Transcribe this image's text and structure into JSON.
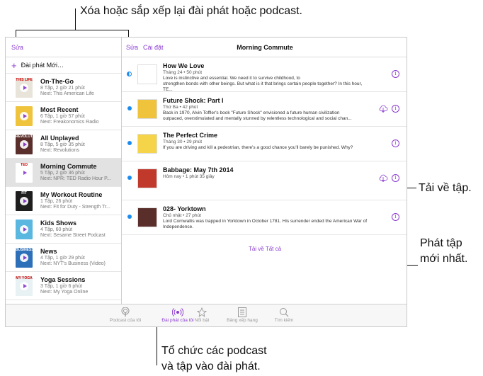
{
  "callouts": {
    "top": "Xóa hoặc sắp xếp lại đài phát hoặc podcast.",
    "download": "Tải về tập.",
    "play_line1": "Phát tập",
    "play_line2": "mới nhất.",
    "organize_line1": "Tổ chức các podcast",
    "organize_line2": "và tập vào đài phát."
  },
  "sidebar": {
    "edit": "Sửa",
    "new_station": "Đài phát Mới…",
    "stations": [
      {
        "name": "On-The-Go",
        "info": "8 Tập, 2 giờ 21 phút",
        "next": "Next: This American Life",
        "art_color": "#e8e4da",
        "art_label": "THIS LIFE"
      },
      {
        "name": "Most Recent",
        "info": "6 Tập, 1 giờ 57 phút",
        "next": "Next: Freakonomics Radio",
        "art_color": "#f0c33c",
        "art_label": ""
      },
      {
        "name": "All Unplayed",
        "info": "8 Tập, 5 giờ 35 phút",
        "next": "Next: Revolutions",
        "art_color": "#5a2f2b",
        "art_label": "REVOLUTIONS"
      },
      {
        "name": "Morning Commute",
        "info": "5 Tập, 2 giờ 36 phút",
        "next": "Next: NPR: TED Radio Hour P...",
        "art_color": "#ffffff",
        "art_label": "TED"
      },
      {
        "name": "My Workout Routine",
        "info": "1 Tập, 26 phút",
        "next": "Next: Fit for Duty - Strength Tr...",
        "art_color": "#1e1e1e",
        "art_label": "FIT"
      },
      {
        "name": "Kids Shows",
        "info": "4 Tập, 60 phút",
        "next": "Next: Sesame Street Podcast",
        "art_color": "#5ab7e0",
        "art_label": ""
      },
      {
        "name": "News",
        "info": "4 Tập, 1 giờ 29 phút",
        "next": "Next: NYT's Business (Video)",
        "art_color": "#2d6fb8",
        "art_label": "BUSINESS"
      },
      {
        "name": "Yoga Sessions",
        "info": "3 Tập, 1 giờ 6 phút",
        "next": "Next: My Yoga Online",
        "art_color": "#e8f1f4",
        "art_label": "MY YOGA"
      }
    ]
  },
  "main": {
    "edit": "Sửa",
    "settings": "Cài đặt",
    "title": "Morning Commute",
    "episodes": [
      {
        "title": "How We Love",
        "meta": "Tháng 24 • 50 phút",
        "desc1": "Love is instinctive and essential. We need it to survive childhood, to",
        "desc2": "strengthen bonds with other beings. But what is it that brings certain people together? In this hour, TE...",
        "dot": "half",
        "cloud": false,
        "thumb_color": "#ffffff"
      },
      {
        "title": "Future Shock: Part I",
        "meta": "Thứ Ba • 42 phút",
        "desc1": "Back in 1970, Alvin Toffler's book \"Future Shock\" envisioned a future human civilization",
        "desc2": "outpaced, overstimulated and mentally stunned by relentless technological and social chan...",
        "dot": "full",
        "cloud": true,
        "thumb_color": "#f0c33c"
      },
      {
        "title": "The Perfect Crime",
        "meta": "Tháng 30 • 29 phút",
        "desc1": "If you are driving and kill a pedestrian, there's a good chance you'll barely be punished. Why?",
        "desc2": "",
        "dot": "full",
        "cloud": false,
        "thumb_color": "#f5d44a"
      },
      {
        "title": "Babbage: May 7th 2014",
        "meta": "Hôm nay • 1 phút 35 giây",
        "desc1": "",
        "desc2": "",
        "dot": "full",
        "cloud": true,
        "thumb_color": "#c0392b"
      },
      {
        "title": "028- Yorktown",
        "meta": "Chủ nhật • 27 phút",
        "desc1": "Lord Cornwallis was trapped in Yorktown in October 1781. His surrender ended the American War of",
        "desc2": "Independence.",
        "dot": "full",
        "cloud": false,
        "thumb_color": "#5a2f2b"
      }
    ],
    "download_all": "Tải về Tất cả"
  },
  "tabbar": {
    "tabs": [
      {
        "label": "Podcast của tôi",
        "icon": "podcast-icon"
      },
      {
        "label": "Đài phát của tôi",
        "icon": "station-icon"
      },
      {
        "label": "Nổi bật",
        "icon": "star-icon"
      },
      {
        "label": "Bảng xếp hạng",
        "icon": "list-icon"
      },
      {
        "label": "Tìm kiếm",
        "icon": "search-icon"
      }
    ],
    "active": 1
  },
  "colors": {
    "accent": "#8a3ad0",
    "unplayed": "#1a8cf0"
  }
}
